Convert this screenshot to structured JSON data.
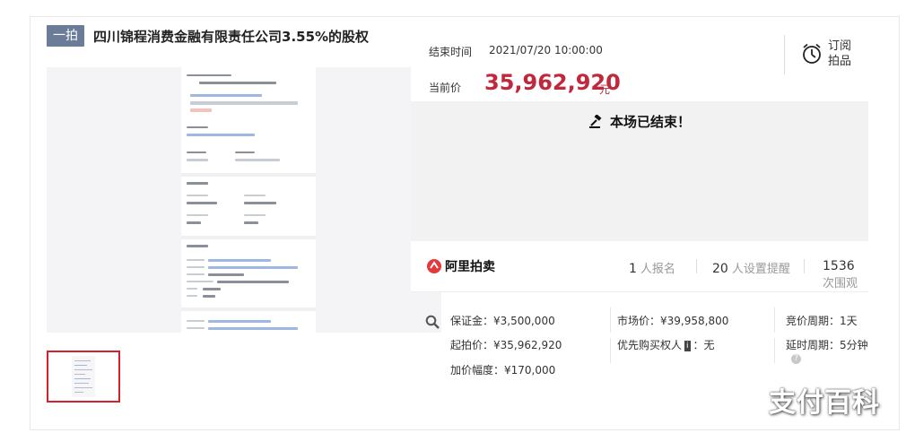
{
  "title": {
    "tag": "一拍",
    "text": "四川锦程消费金融有限责任公司3.55%的股权"
  },
  "auction": {
    "end_time_label": "结束时间",
    "end_time_value": "2021/07/20 10:00:00",
    "price_label": "当前价",
    "price_value": "35,962,920",
    "price_unit": "元",
    "subscribe_label": "订阅拍品",
    "status_text": "本场已结束！"
  },
  "stats": {
    "brand": "阿里拍卖",
    "signups_num": "1",
    "signups_unit": "人报名",
    "reminders_num": "20",
    "reminders_unit": "人设置提醒",
    "views_num": "1536",
    "views_unit": "次围观"
  },
  "details": {
    "deposit": "保证金：¥3,500,000",
    "start_price": "起拍价：¥35,962,920",
    "increment": "加价幅度：¥170,000",
    "market_price": "市场价：¥39,958,800",
    "priority_prefix": "优先购买权人",
    "priority_badge": "i",
    "priority_value": "：无",
    "bid_cycle": "竞价周期：1天",
    "delay_cycle": "延时周期：5分钟"
  },
  "watermark": "支付百科",
  "colors": {
    "accent": "#c0283b",
    "tag_bg": "#6a7c98",
    "thumb_border": "#d3212d"
  }
}
